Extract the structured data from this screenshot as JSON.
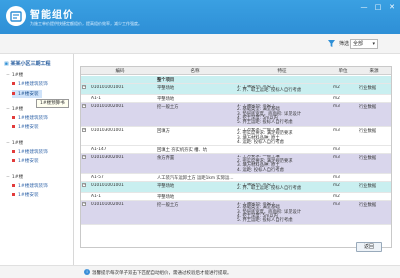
{
  "app": {
    "title": "智能组价",
    "subtitle": "为施工单价提供快捷定额组价，提高组价效率，减少工作强度。",
    "window_buttons": [
      "—",
      "□",
      "✕"
    ]
  },
  "toolbar": {
    "filter_label": "筛选",
    "filter_value": "全部"
  },
  "sidebar": {
    "root": "某某小区三期工程",
    "nodes": [
      {
        "label": "1#楼",
        "leaves": [
          "1#楼建筑装饰",
          "1#楼安装"
        ]
      },
      {
        "label": "1#楼",
        "leaves": [
          "1#楼建筑装饰",
          "1#楼安装"
        ]
      },
      {
        "label": "1#楼",
        "leaves": [
          "1#楼建筑装饰",
          "1#楼安装"
        ]
      },
      {
        "label": "1#楼",
        "leaves": [
          "1#楼建筑装饰",
          "1#楼安装"
        ]
      }
    ],
    "tooltip": "1#楼预算书"
  },
  "grid": {
    "columns": [
      "编码",
      "名称",
      "特征",
      "单位",
      "来源"
    ],
    "rows": [
      {
        "code": "",
        "name": "整个项目",
        "feature": "",
        "unit": "",
        "source": "",
        "color": "cyan",
        "bold": true
      },
      {
        "code": "010101001001",
        "name": "平整场地",
        "feature": "1. 土壤类别: 三类土\n2. 弃、取土运距: 投标人自行考虑",
        "unit": "m2",
        "source": "行业数据",
        "color": "cyan",
        "toggle": true
      },
      {
        "code": "A1-1",
        "name": "平整场地",
        "feature": "",
        "unit": "m2",
        "source": "",
        "color": "white"
      },
      {
        "code": "010101002001",
        "name": "挖一般土方",
        "feature": "1. 土壤类别: 三类土\n2. 基础类型: 满堂基础\n3. 垫层底宽度、底面积: 详见设计\n4. 挖土深度: 5m以内\n5. 弃土运距: 投标人自行考虑",
        "unit": "m3",
        "source": "行业数据",
        "color": "purple",
        "toggle": true
      },
      {
        "code": "010103001001",
        "name": "回填方",
        "feature": "1. 土方要求: 一般土壤\n2. 密实度要求: 满足规范要求\n3. 填方材料品种: 原土\n4. 运距: 投标人自行考虑",
        "unit": "m3",
        "source": "行业数据",
        "color": "white",
        "toggle": true
      },
      {
        "code": "A1-147",
        "name": "回填土 夯实机夯实 槽、坑",
        "feature": "",
        "unit": "m3",
        "source": "",
        "color": "white"
      },
      {
        "code": "010103002001",
        "name": "余方弃置",
        "feature": "1. 土方要求: 一般土壤\n2. 密实度要求: 满足规范要求\n3. 填方材料品种: 原土\n4. 运距: 投标人自行考虑",
        "unit": "m3",
        "source": "行业数据",
        "color": "purple",
        "toggle": true
      },
      {
        "code": "A1-57",
        "name": "人工装汽车运卸土方 运距1km 实际运…",
        "feature": "",
        "unit": "m3",
        "source": "",
        "color": "white"
      },
      {
        "code": "010101001001",
        "name": "平整场地",
        "feature": "1. 土壤类别: 三类土\n2. 弃、取土运距: 投标人自行考虑",
        "unit": "m2",
        "source": "行业数据",
        "color": "cyan",
        "toggle": true
      },
      {
        "code": "A1-1",
        "name": "平整场地",
        "feature": "",
        "unit": "m2",
        "source": "",
        "color": "white"
      },
      {
        "code": "010101002001",
        "name": "挖一般土方",
        "feature": "1. 土壤类别: 三类土\n2. 基础类型: 满堂基础\n3. 垫层底宽度、底面积: 详见设计\n4. 挖土深度: 5m以内\n5. 弃土运距: 投标人自行考虑",
        "unit": "m3",
        "source": "行业数据",
        "color": "purple",
        "toggle": true
      }
    ]
  },
  "buttons": {
    "back": "返回"
  },
  "status": {
    "text": "温馨提示每次单子双击下匹配自动组价，需通过校验后才能进行提取。"
  },
  "colors": {
    "brand": "#2e8fd6",
    "row_cyan": "#c9eff0",
    "row_purple": "#d9d6ec",
    "leaf_marker": "#e23b3b"
  }
}
